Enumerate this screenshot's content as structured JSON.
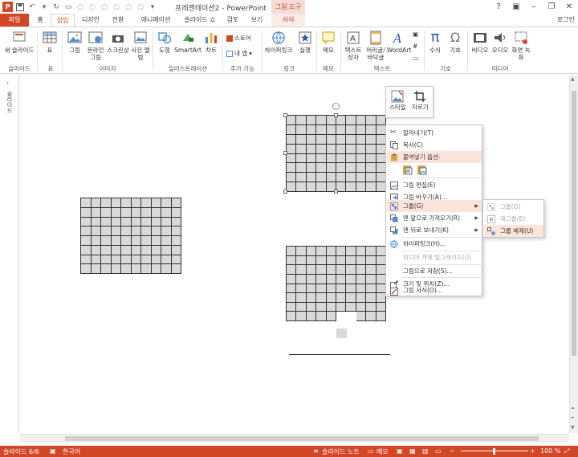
{
  "window": {
    "title": "프레젠테이션2 - PowerPoint",
    "context_tab_group": "그림 도구",
    "login": "로그인"
  },
  "tabs": [
    {
      "label": "파일"
    },
    {
      "label": "홈"
    },
    {
      "label": "삽입"
    },
    {
      "label": "디자인"
    },
    {
      "label": "전환"
    },
    {
      "label": "애니메이션"
    },
    {
      "label": "슬라이드 쇼"
    },
    {
      "label": "검토"
    },
    {
      "label": "보기"
    },
    {
      "label": "서식"
    }
  ],
  "ribbon": {
    "new_slide": "새 슬라이드",
    "table": "표",
    "picture": "그림",
    "online_picture": "온라인 그림",
    "screenshot": "스크린샷",
    "photo_album": "사진 앨범",
    "shapes": "도형",
    "smartart": "SmartArt",
    "chart": "차트",
    "store": "스토어",
    "my_apps": "내 앱",
    "hyperlink": "하이퍼링크",
    "action": "실행",
    "comment": "메모",
    "textbox": "텍스트 상자",
    "header_footer": "머리글/바닥글",
    "wordart": "WordArt",
    "equation": "수식",
    "symbol": "기호",
    "video": "비디오",
    "audio": "오디오",
    "screen_recording": "화면 녹화",
    "groups": {
      "slides": "슬라이드",
      "tables": "표",
      "images": "이미지",
      "illustrations": "일러스트레이션",
      "addins": "추가 기능",
      "links": "링크",
      "comments": "메모",
      "text": "텍스트",
      "symbols": "기호",
      "media": "미디어"
    }
  },
  "left_pane": {
    "label": "슬라이드"
  },
  "mini_toolbar": {
    "style": "스타일",
    "crop": "자르기"
  },
  "context_menu": {
    "cut": "잘라내기(T)",
    "copy": "복사(C)",
    "paste_options": "붙여넣기 옵션:",
    "edit_picture": "그림 편집(E)",
    "change_picture": "그림 바꾸기(A)...",
    "group": "그룹(G)",
    "bring_to_front": "맨 앞으로 가져오기(R)",
    "send_to_back": "맨 뒤로 보내기(K)",
    "hyperlink": "하이퍼링크(H)...",
    "upload_media": "미디어 개체 업그레이드(U)",
    "save_as_picture": "그림으로 저장(S)...",
    "size_position": "크기 및 위치(Z)...",
    "format_picture": "그림 서식(O)..."
  },
  "submenu": {
    "group": "그룹(G)",
    "regroup": "재그룹(E)",
    "ungroup": "그룹 해제(U)"
  },
  "status": {
    "slide": "슬라이드 6/6",
    "language": "한국어",
    "notes": "슬라이드 노트",
    "comments": "메모",
    "zoom": "100 %"
  },
  "colors": {
    "accent": "#d24726",
    "cell_fill": "#d9d9d9",
    "highlight": "#fbe4dc"
  }
}
